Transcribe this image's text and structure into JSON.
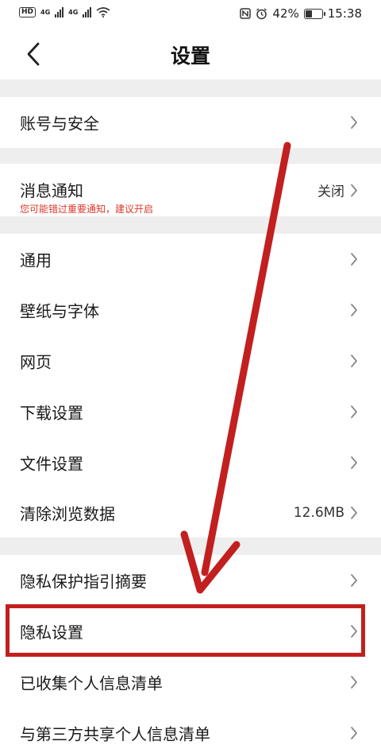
{
  "status_bar": {
    "hd_label": "HD",
    "signal_labels": [
      "4G",
      "4G"
    ],
    "battery_percent_text": "42%",
    "battery_level": 0.42,
    "time": "15:38"
  },
  "header": {
    "title": "设置"
  },
  "rows": {
    "account": {
      "label": "账号与安全"
    },
    "notifications": {
      "label": "消息通知",
      "subtitle": "您可能错过重要通知，建议开启",
      "value": "关闭"
    },
    "general": {
      "label": "通用"
    },
    "wallpaper": {
      "label": "壁纸与字体"
    },
    "webpage": {
      "label": "网页"
    },
    "download": {
      "label": "下载设置"
    },
    "files": {
      "label": "文件设置"
    },
    "clear_data": {
      "label": "清除浏览数据",
      "value": "12.6MB"
    },
    "privacy_summary": {
      "label": "隐私保护指引摘要"
    },
    "privacy_settings": {
      "label": "隐私设置"
    },
    "collected_info": {
      "label": "已收集个人信息清单"
    },
    "third_party": {
      "label": "与第三方共享个人信息清单"
    }
  },
  "colors": {
    "annotation_red": "#c21f1f",
    "warning_text": "#d83a2b",
    "section_gap": "#eeeeee"
  },
  "icons": {
    "back": "chevron-left-icon",
    "row_arrow": "chevron-right-icon",
    "wifi": "wifi-icon",
    "nfc": "nfc-icon",
    "alarm": "alarm-icon",
    "battery": "battery-icon"
  }
}
